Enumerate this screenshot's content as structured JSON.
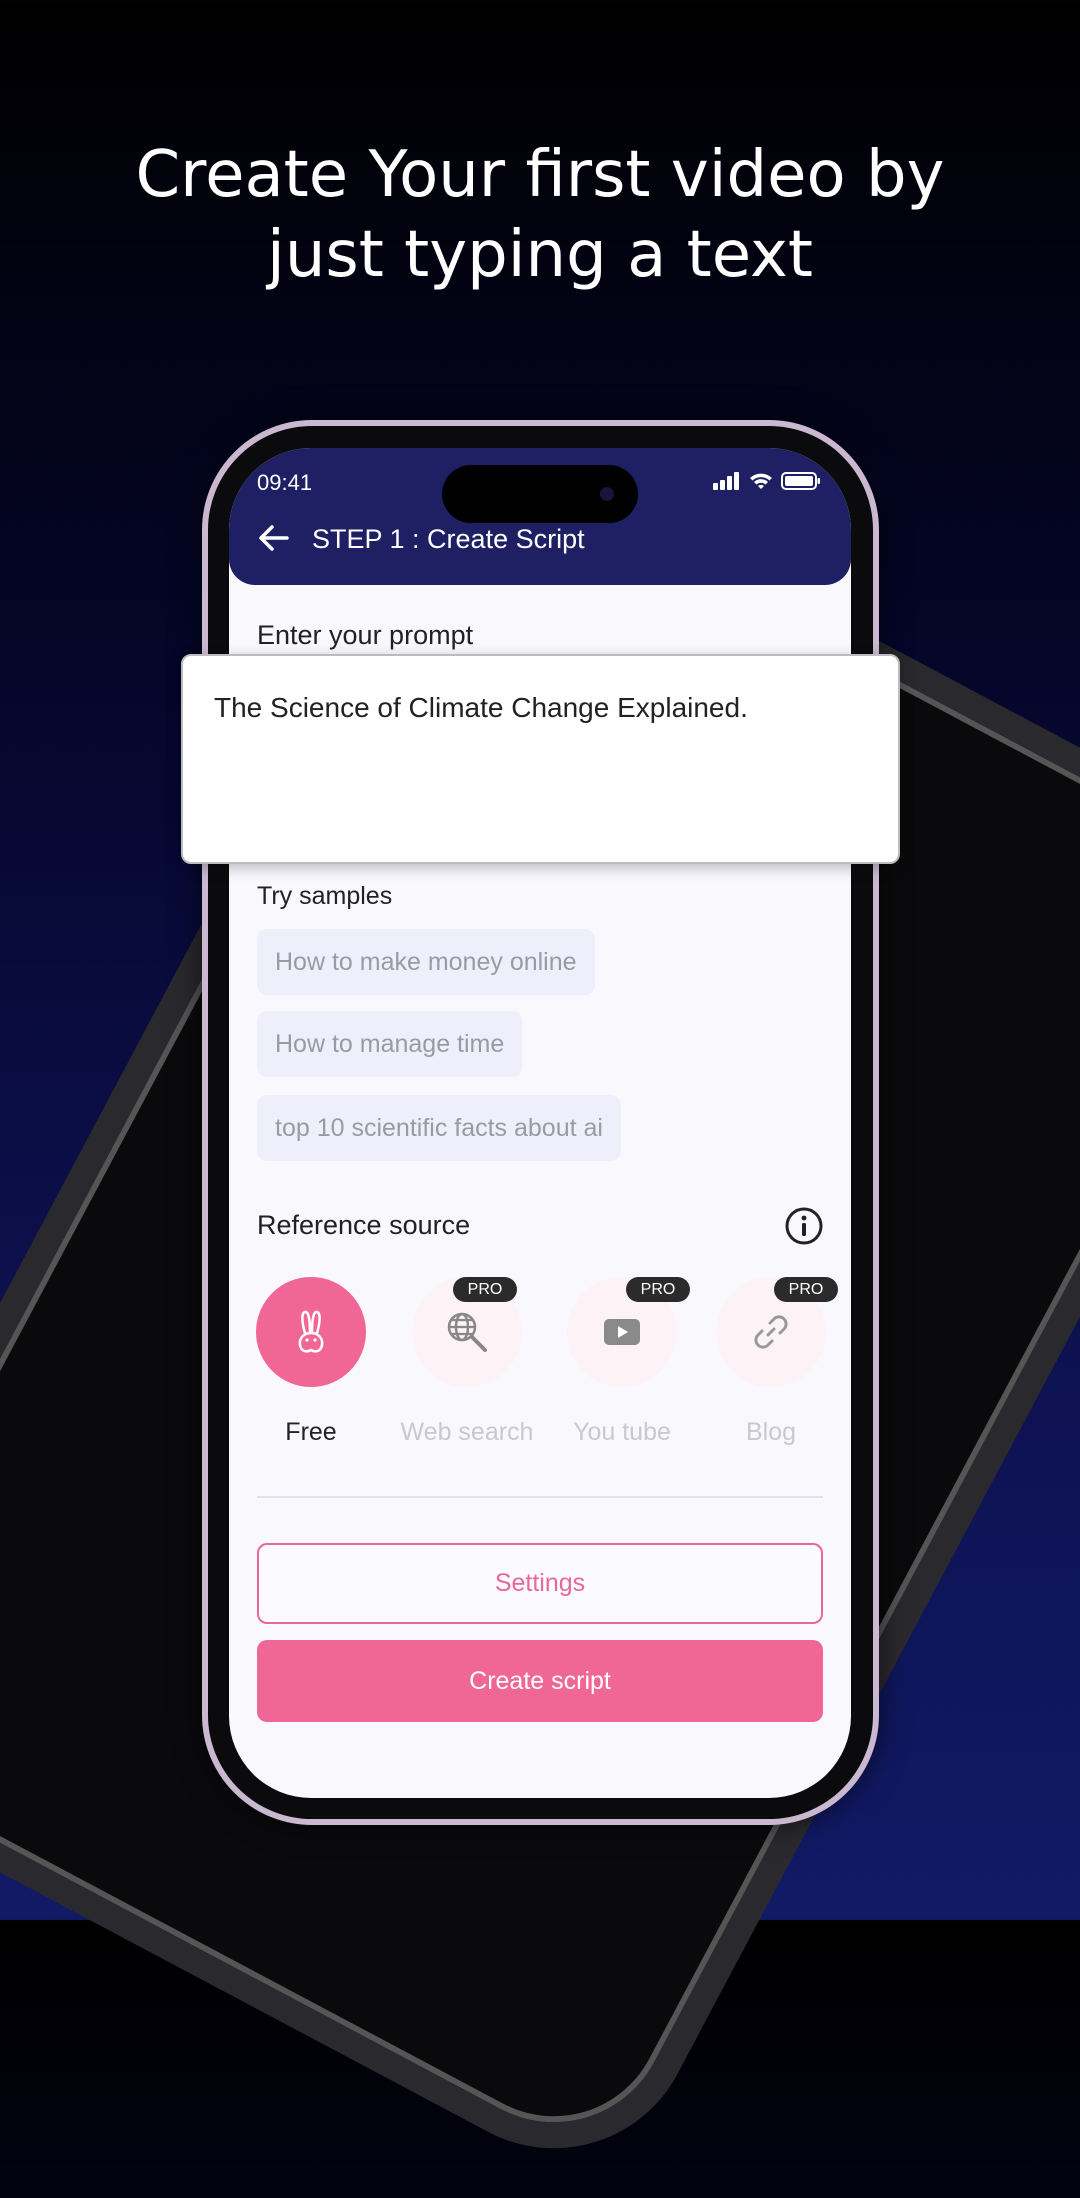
{
  "headline": {
    "line1": "Create Your first video by",
    "line2": "just typing a text"
  },
  "status_bar": {
    "time": "09:41",
    "icons": [
      "signal-icon",
      "wifi-icon",
      "battery-icon"
    ]
  },
  "header": {
    "title": "STEP 1 : Create Script",
    "back_icon": "arrow-left-icon"
  },
  "prompt": {
    "label": "Enter your prompt",
    "value": "The Science of Climate Change Explained."
  },
  "samples": {
    "label": "Try samples",
    "items": [
      "How to make money online",
      "How to manage time",
      "top 10 scientific facts about ai"
    ]
  },
  "reference": {
    "label": "Reference source",
    "info_icon": "info-icon",
    "sources": [
      {
        "label": "Free",
        "icon": "rabbit-icon",
        "selected": true
      },
      {
        "label": "Web search",
        "icon": "globe-search-icon",
        "badge": "PRO"
      },
      {
        "label": "You tube",
        "icon": "youtube-icon",
        "badge": "PRO"
      },
      {
        "label": "Blog",
        "icon": "link-icon",
        "badge": "PRO"
      }
    ]
  },
  "buttons": {
    "settings": "Settings",
    "create": "Create script"
  },
  "colors": {
    "accent": "#f06795",
    "header": "#1f2063",
    "chip_bg": "#efeffb"
  }
}
